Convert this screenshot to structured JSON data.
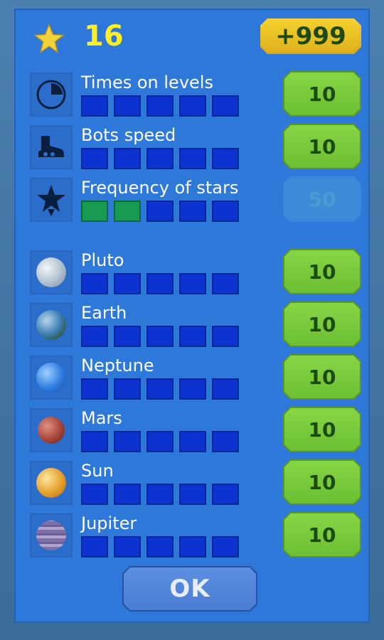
{
  "header": {
    "star_icon": "star-icon",
    "star_count": "16",
    "add_button_label": "+999"
  },
  "upgrades": [
    {
      "label": "Times on levels",
      "icon": "clock-icon",
      "level": 0,
      "price": "10",
      "enabled": true
    },
    {
      "label": "Bots speed",
      "icon": "boot-icon",
      "level": 0,
      "price": "10",
      "enabled": true
    },
    {
      "label": "Frequency of stars",
      "icon": "star-burst-icon",
      "level": 2,
      "price": "50",
      "enabled": false
    }
  ],
  "planets": [
    {
      "label": "Pluto",
      "icon": "pluto-icon",
      "level": 0,
      "price": "10",
      "color": "#c9d6e0"
    },
    {
      "label": "Earth",
      "icon": "earth-icon",
      "level": 0,
      "price": "10",
      "color": "#3f7fb5"
    },
    {
      "label": "Neptune",
      "icon": "neptune-icon",
      "level": 0,
      "price": "10",
      "color": "#2f7de0"
    },
    {
      "label": "Mars",
      "icon": "mars-icon",
      "level": 0,
      "price": "10",
      "color": "#a8453a"
    },
    {
      "label": "Sun",
      "icon": "sun-icon",
      "level": 0,
      "price": "10",
      "color": "#e3a12a"
    },
    {
      "label": "Jupiter",
      "icon": "jupiter-icon",
      "level": 0,
      "price": "10",
      "color": "#8b7fae"
    }
  ],
  "max_level": 5,
  "ok_label": "OK"
}
